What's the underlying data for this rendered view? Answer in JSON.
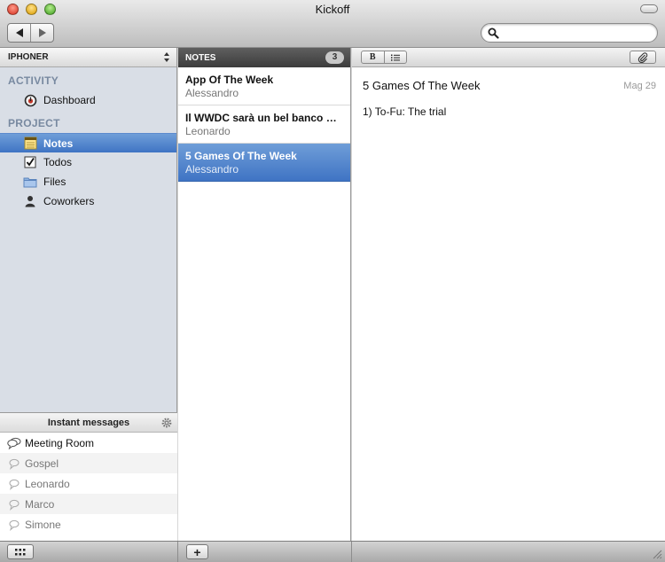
{
  "window": {
    "title": "Kickoff"
  },
  "toolbar": {
    "back_label": "back",
    "forward_label": "forward",
    "search_placeholder": "",
    "search_value": ""
  },
  "sidebar": {
    "project": "IPHONER",
    "sections": [
      {
        "header": "ACTIVITY",
        "items": [
          {
            "label": "Dashboard",
            "icon": "dashboard-icon"
          }
        ]
      },
      {
        "header": "PROJECT",
        "items": [
          {
            "label": "Notes",
            "icon": "notes-icon",
            "selected": true
          },
          {
            "label": "Todos",
            "icon": "todos-checkbox-icon"
          },
          {
            "label": "Files",
            "icon": "folder-icon"
          },
          {
            "label": "Coworkers",
            "icon": "person-icon"
          }
        ]
      }
    ],
    "instant_messages": {
      "title": "Instant messages",
      "rooms": [
        "Meeting Room",
        "Gospel",
        "Leonardo",
        "Marco",
        "Simone"
      ]
    }
  },
  "notes": {
    "header": "NOTES",
    "count": "3",
    "items": [
      {
        "title": "App Of The Week",
        "author": "Alessandro"
      },
      {
        "title": "Il WWDC sarà un bel banco di...",
        "author": "Leonardo"
      },
      {
        "title": "5 Games Of The Week",
        "author": "Alessandro",
        "selected": true
      }
    ]
  },
  "editor": {
    "bold_label": "B",
    "title": "5 Games Of The Week",
    "date": "Mag 29",
    "body": "1) To-Fu: The trial"
  },
  "bottom": {
    "add_label": "+"
  },
  "colors": {
    "selection": "#3f74c4",
    "sidebar_bg": "#d9dee6",
    "section_header": "#7889a0"
  }
}
